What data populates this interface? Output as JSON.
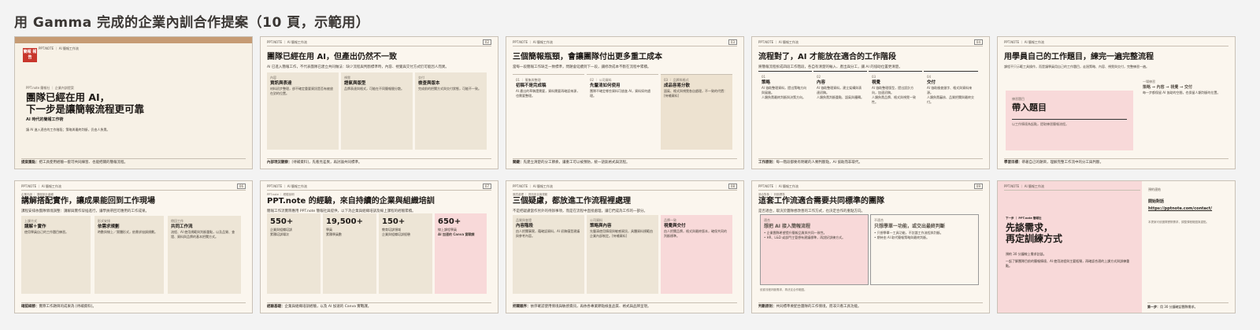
{
  "header": {
    "title": "用 Gamma 完成的企業內訓合作提案（10 頁，示範用）"
  },
  "s1": {
    "tag": "PPT.note 簡報社 ｜ 企業內訓提案",
    "title1": "團隊已經在用 AI，",
    "title2": "下一步是讓簡報流程更可靠",
    "subtitle": "AI 時代的簡報工作術",
    "desc": "讓 AI 進入適合的工作階段；策略與最終判斷，仍由人負責。",
    "foot_b": "提案重點：",
    "foot": "把工具使用經驗一套可共同練習、也能把關的簡報流程。",
    "logo": "簡報 報告"
  },
  "s2": {
    "head": "PPT.NOTE ｜ AI 簡報工作流",
    "num": "02",
    "title": "團隊已經在用 AI，但產出仍然不一致",
    "sub": "AI 已進入簡報工作，不代表團隊已建立共同做法：缺少流程與判斷標準時，內容、視覺與交付方式仍可能因人而異。",
    "cards": [
      {
        "k": "內容",
        "h": "資訊與表達",
        "d": "材料初步整理，卻不確定重要資訊是否有被放在對的位置。"
      },
      {
        "k": "視覺",
        "h": "語氣與版型",
        "d": "品牌表達與格式，可能在不同簡報間分散。"
      },
      {
        "k": "交付",
        "h": "檢查與版本",
        "d": "完成前的把關方式與交付狀態，可能不一致。"
      }
    ],
    "foot_b": "內部現況觀察：",
    "foot": "[待補資料]，先看見差異，再討論共同標準。"
  },
  "s3": {
    "head": "PPT.NOTE ｜ AI 簡報工作流",
    "num": "03",
    "title": "三個簡報瓶頸，會讓團隊付出更多重工成本",
    "sub": "當每一段簡報工作缺乏一致標準，問題會延續到下一段，讓修改成本不斷在流程中累積。",
    "cards": [
      {
        "k": "01 ｜ 蒐集與整理",
        "h": "初稿不是完成稿",
        "d": "AI 產出的草稿還需要，資料需要再確認來源，也需要整理。"
      },
      {
        "k": "02 ｜ 公司資料",
        "h": "先釐清如何使用",
        "d": "團隊不確定哪些資料可放進 AI，資料如何處理。"
      },
      {
        "k": "03 ｜ 品牌與格式",
        "h": "成品容易分散",
        "d": "語氣、格式與視覺各自處理，不一致的代價：[待補資料]"
      }
    ],
    "foot_b": "關鍵：",
    "foot": "先建立清楚的分工節奏，讓重工可以被預防，統一語氣格式與流程。"
  },
  "s4": {
    "head": "PPT.NOTE ｜ AI 簡報工作流",
    "num": "04",
    "title": "流程對了，AI 才能放在適合的工作階段",
    "sub": "將簡報流程拆成四段工作階段，各自有清楚的輸入、產出與分工，讓 AI 的協助位置更清楚。",
    "cols": [
      {
        "n": "01",
        "h": "策略",
        "a": "AI 協助整理資料，提出策略方向與風險。",
        "b": "人類負責最終判斷與決策方向。"
      },
      {
        "n": "02",
        "h": "內容",
        "a": "AI 協助整理資料，建立架構與表達初稿。",
        "b": "人類負責判斷重點、語氣與邏輯。"
      },
      {
        "n": "03",
        "h": "視覺",
        "a": "AI 協助整理版型，提出設計方向，加速初稿。",
        "b": "人類負責品牌、格式與視覺一致性。"
      },
      {
        "n": "04",
        "h": "交付",
        "a": "AI 協助檢查錯字、格式與資料來源。",
        "b": "人類負責審核、品質把關與最終交付。"
      }
    ],
    "foot_b": "工作原則：",
    "foot": "每一階段都要有明確的人類判斷點，AI 協助而非取代。"
  },
  "s5": {
    "head": "PPT.NOTE ｜ AI 簡報工作流",
    "title": "用學員自己的工作題目，練完一遍完整流程",
    "sub": "課程不只示範工具操作，而是讓學員用自己的工作題目，走過策略、內容、視覺與交付，完整練習一遍。",
    "pink_k": "練習題目",
    "pink_h": "帶入題目",
    "pink_d": "以工作情境為起點，提取練習簡報流程。",
    "side_k": "一場練習",
    "side_h": "策略 → 內容 → 視覺 → 交付",
    "side_d": "每一步都保留 AI 協助的空間，也保留人類判斷的位置。",
    "foot_b": "學習目標：",
    "foot": "帶著自己的題目，理解完整工作流中的分工與判斷。"
  },
  "s6": {
    "head": "PPT.NOTE ｜ AI 簡報工作流",
    "num": "06",
    "small": "企業內訓 ｜ 課程設計邏輯",
    "title": "講解搭配實作，讓成果能回到工作現場",
    "sub": "課程安排依團隊情境調整：講解與實作穿插進行，讓學員帶回可應用的工作成果。",
    "cards": [
      {
        "k": "上課方式",
        "h": "講解＋實作",
        "d": "使用學員自己的工作題目練習。"
      },
      {
        "k": "形式安排",
        "h": "依需求規劃",
        "d": "時數與線上／實體形式，依需求協調規劃。"
      },
      {
        "k": "帶回工作",
        "h": "共同工作流",
        "d": "流程、AI 使用規範與判斷重點，以及品質、查證、資料與品牌的基本把關方式。"
      }
    ],
    "foot_b": "確認細節：",
    "foot": "實際工作題目的成果為 [待補資料]。"
  },
  "s7": {
    "head": "PPT.NOTE ｜ AI 簡報工作流",
    "num": "07",
    "small": "PPT.note ｜ 經驗說明",
    "title": "PPT.note 的經驗，來自持續的企業與組織培訓",
    "sub": "簡報工作流實際應用 PPT.note 簡報社與提供，以下為企業與組織培訓及線上課程的經驗累積。",
    "stats": [
      {
        "v": "550+",
        "a": "企業與組織培訓",
        "b": "累積培訓場次"
      },
      {
        "v": "19,500+",
        "a": "學員",
        "b": "累積學員數"
      },
      {
        "v": "150+",
        "a": "教育培訓領域",
        "b": "企業與組織培訓經驗"
      },
      {
        "v": "650+",
        "a": "線上課程學員",
        "b": "AI 加速的 Canva 實戰課"
      }
    ],
    "foot_b": "經驗基礎：",
    "foot": "企業與組織培訓經驗，以及 AI 加速的 Canva 實戰課。"
  },
  "s8": {
    "head": "PPT.NOTE ｜ AI 簡報工作流",
    "num": "08",
    "small": "風險處理 ｜ 資訊安全與規範",
    "title": "三個疑慮，都放進工作流程裡處理",
    "sub": "不是把疑慮當作另外的待辦事項，而是在流程中直接處理，讓它們成為工作的一部分。",
    "cards": [
      {
        "k": "品質與查證",
        "h": "內容階段",
        "d": "由人把關事實，藉確認資料，AI 初稿僅是建議與參考內容。"
      },
      {
        "k": "公司資料",
        "h": "策略與內容",
        "d": "先釐清使用情境與敏感資訊，具體資料規範由企業內部制定。[待補資料]"
      },
      {
        "k": "品牌一致",
        "h": "視覺與交付",
        "d": "由人把關品牌，格式與最終版本，確保共同的判斷標準。",
        "pink": true
      }
    ],
    "foot_b": "把關順序：",
    "foot": "依序確認使用情境與敏感資訊，再依各專業節點檢查品質、格式與品牌呈現。"
  },
  "s9": {
    "head": "PPT.NOTE ｜ AI 簡報工作流",
    "num": "09",
    "small": "適合對象 ｜ 判斷標準",
    "title": "這套工作流適合需要共同標準的團隊",
    "sub": "是否適合，取決於團隊想改善的工作方式，也決定合作的重點方向。",
    "fit_k": "適合",
    "fit_h": "想把 AI 接入簡報流程",
    "fit_items": [
      "企業團隊希望提升簡報品質與共同一致性。",
      "HR、L&D 或部門主管想有建議標準，再說好訓練方式。"
    ],
    "no_k": "不適合",
    "no_h": "只想學單一功能，或交出最終判斷",
    "no_items": [
      "只想學單一工具功能，不討論工作流程與判斷。",
      "期待由 AI 取代簡報策略與最終判斷。"
    ],
    "note": "依據流程判斷需求，再決定合作範圍。",
    "foot_b": "判斷原則：",
    "foot": "共同標準要配合團隊的工作情境，而非只看工具功能。"
  },
  "s10": {
    "head": "PPT.NOTE ｜ AI 簡報工作流",
    "tag": "下一步 ｜ PPT.note 簡報社",
    "title1": "先談需求，",
    "title2": "再定訓練方式",
    "desc1": "預約 30 分鐘線上需求訪談。",
    "desc2": "一起了解團隊目前的簡報情境、AI 使用流程與主要瓶頸，再確認合適的上課方式與訓練重點。",
    "side_k": "預約連結",
    "side_h": "開始對話",
    "side_link": "https://pptnote.com/contact/",
    "side_note": "本提案可依團隊實際需求，調整課程範圍與重點。",
    "foot_b": "第一步：",
    "foot": "用 30 分鐘確認團隊需求。"
  }
}
